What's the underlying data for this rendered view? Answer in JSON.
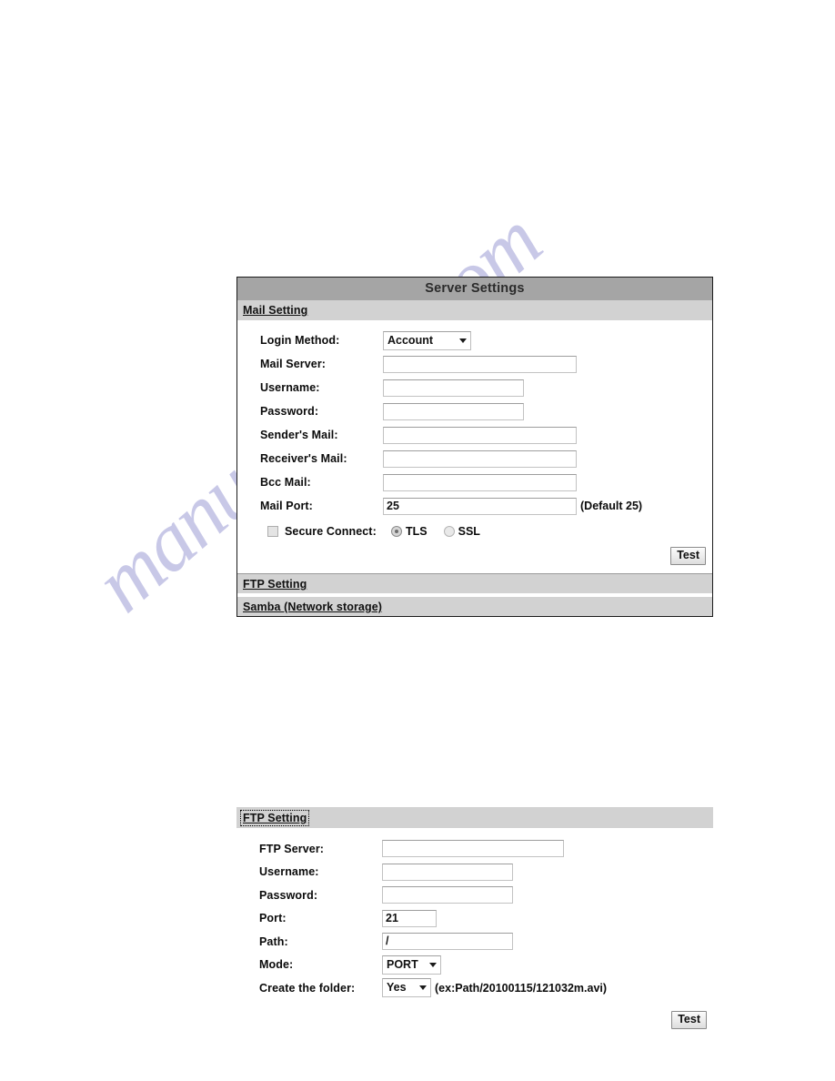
{
  "watermark": {
    "text": "manualshive.com",
    "color": "#c4c4e6"
  },
  "panel_server": {
    "title": "Server Settings",
    "sections": {
      "mail": "Mail Setting",
      "ftp": "FTP Setting",
      "samba": "Samba (Network storage)"
    },
    "fields": {
      "login_method": {
        "label": "Login Method:",
        "value": "Account",
        "caret": "chevron-down-icon"
      },
      "mail_server": {
        "label": "Mail Server:",
        "value": "",
        "placeholder": ""
      },
      "username": {
        "label": "Username:",
        "value": "",
        "placeholder": ""
      },
      "password": {
        "label": "Password:",
        "value": "",
        "placeholder": ""
      },
      "senders_mail": {
        "label": "Sender's Mail:",
        "value": "",
        "placeholder": ""
      },
      "receivers_mail": {
        "label": "Receiver's Mail:",
        "value": "",
        "placeholder": ""
      },
      "bcc_mail": {
        "label": "Bcc Mail:",
        "value": "",
        "placeholder": ""
      },
      "mail_port": {
        "label": "Mail Port:",
        "value": "25",
        "hint": "(Default 25)"
      },
      "secure_connect": {
        "label": "Secure Connect:",
        "checked": false,
        "options": [
          "TLS",
          "SSL"
        ],
        "selected": "TLS"
      }
    },
    "test_button": "Test"
  },
  "panel_ftp": {
    "section_title": "FTP Setting",
    "fields": {
      "ftp_server": {
        "label": "FTP Server:",
        "value": "",
        "placeholder": ""
      },
      "username": {
        "label": "Username:",
        "value": "",
        "placeholder": ""
      },
      "password": {
        "label": "Password:",
        "value": "",
        "placeholder": ""
      },
      "port": {
        "label": "Port:",
        "value": "21"
      },
      "path": {
        "label": "Path:",
        "value": "/"
      },
      "mode": {
        "label": "Mode:",
        "value": "PORT",
        "caret": "chevron-down-icon"
      },
      "create_folder": {
        "label": "Create the folder:",
        "value": "Yes",
        "caret": "chevron-down-icon",
        "hint": "(ex:Path/20100115/121032m.avi)"
      }
    },
    "test_button": "Test"
  }
}
